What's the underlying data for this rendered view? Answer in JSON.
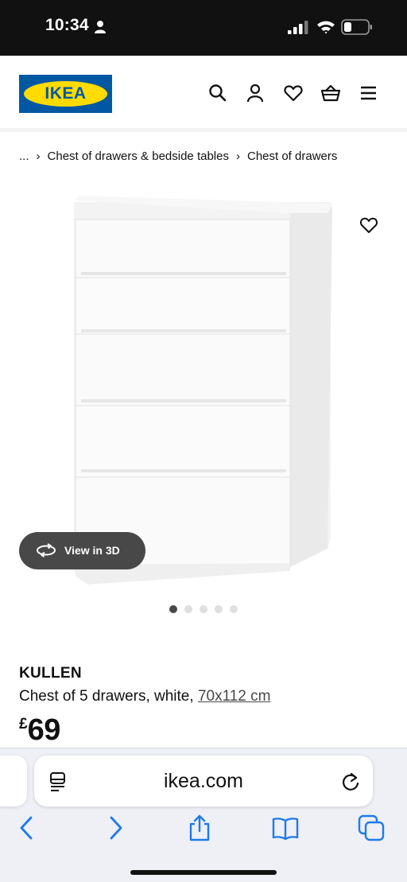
{
  "status_bar": {
    "time": "10:34",
    "icons": [
      "person-icon",
      "signal-icon",
      "wifi-icon",
      "battery-icon"
    ]
  },
  "header": {
    "logo_text": "IKEA",
    "brand_colors": {
      "blue": "#0058a3",
      "yellow": "#ffdb00"
    },
    "icons": [
      "search-icon",
      "account-icon",
      "heart-icon",
      "basket-icon",
      "menu-icon"
    ]
  },
  "breadcrumb": {
    "items": [
      "...",
      "Chest of drawers & bedside tables",
      "Chest of drawers"
    ],
    "separator": "›"
  },
  "gallery": {
    "view_3d_label": "View in 3D",
    "dot_count": 5,
    "active_dot": 0,
    "favorite_icon": "heart-icon"
  },
  "product": {
    "name": "KULLEN",
    "description": "Chest of 5 drawers, white, ",
    "size": "70x112 cm",
    "currency": "£",
    "price": "69"
  },
  "browser": {
    "url": "ikea.com",
    "toolbar": [
      "back-icon",
      "forward-icon",
      "share-icon",
      "bookmarks-icon",
      "tabs-icon"
    ],
    "accent": "#1f7aeb"
  }
}
